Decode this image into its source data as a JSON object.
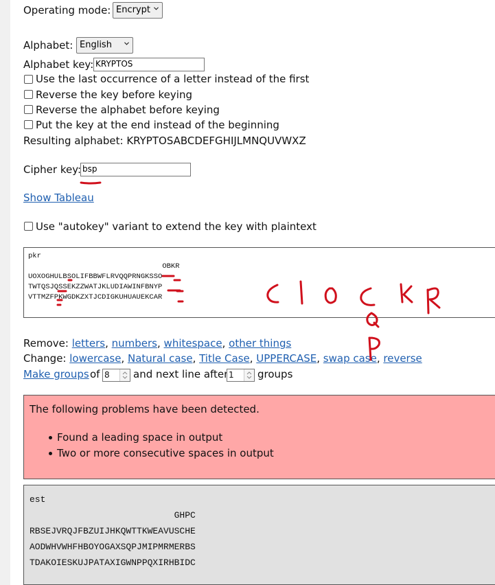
{
  "controls": {
    "operating_mode_label": "Operating mode:",
    "operating_mode_value": "Encrypt",
    "alphabet_label": "Alphabet:",
    "alphabet_value": "English",
    "alphabet_key_label": "Alphabet key:",
    "alphabet_key_value": "KRYPTOS",
    "options": [
      {
        "label": "Use the last occurrence of a letter instead of the first",
        "checked": false
      },
      {
        "label": "Reverse the key before keying",
        "checked": false
      },
      {
        "label": "Reverse the alphabet before keying",
        "checked": false
      },
      {
        "label": "Put the key at the end instead of the beginning",
        "checked": false
      }
    ],
    "resulting_alphabet_text": "Resulting alphabet: KRYPTOSABCDEFGHIJLMNQUVWXZ",
    "cipher_key_label": "Cipher key:",
    "cipher_key_value": "bsp",
    "show_tableau_link": "Show Tableau",
    "autokey_label": "Use \"autokey\" variant to extend the key with plaintext"
  },
  "input_text": {
    "lines": [
      "pkr",
      "                               OBKR",
      "UOXOGHULBSOLIFBBWFLRVQQPRNGKSSO",
      "TWTQSJQSSEKZZWATJKLUDIAWINFBNYP",
      "VTTMZFPKWGDKZXTJCDIGKUHUAUEKCAR"
    ]
  },
  "transform": {
    "remove_label": "Remove:",
    "remove_links": [
      "letters",
      "numbers",
      "whitespace",
      "other things"
    ],
    "change_label": "Change:",
    "change_links": [
      "lowercase",
      "Natural case",
      "Title Case",
      "UPPERCASE",
      "swap case",
      "reverse"
    ],
    "make_groups_link": "Make groups",
    "of_label": "of",
    "group_size": "8",
    "next_line_label": "and next line after",
    "groups_per_line": "1",
    "groups_label": "groups"
  },
  "problems": {
    "heading": "The following problems have been detected.",
    "items": [
      "Found a leading space in output",
      "Two or more consecutive spaces in output"
    ]
  },
  "output_text": {
    "lines": [
      "est",
      "                           GHPC",
      "RBSEJVRQJFBZUIJHKQWTTKWEAVUSCHE",
      "AODWHVWHFHBOYOGAXSQPJMIPMRMERBS",
      "TDAKOIESKUJPATAXIGWNPPQXIRHBIDC"
    ]
  },
  "annotations": {
    "color": "#d0101c",
    "handwritten": [
      "CLOCKR",
      "Q",
      "P"
    ]
  }
}
